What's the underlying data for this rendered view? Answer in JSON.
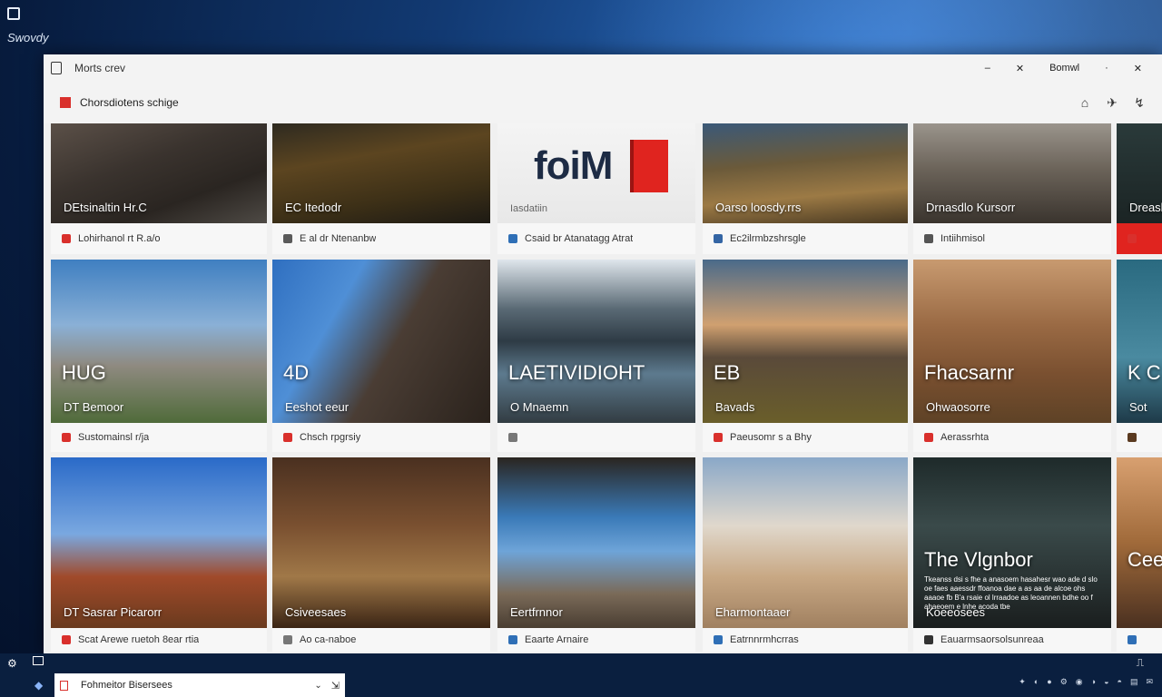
{
  "desktop": {
    "label": "Swovdy"
  },
  "window": {
    "title": "Morts crev",
    "controls": {
      "minimize": "–",
      "restore": "✕",
      "user": "Bomwl",
      "more": "·",
      "close": "✕"
    }
  },
  "toolbar": {
    "title": "Chorsdiotens schige",
    "buttons": [
      "⌂",
      "✈",
      "↯"
    ]
  },
  "tiles": [
    {
      "caption": "DEtsinaltin Hr.C",
      "meta": "Lohirhanol rt R.a/o",
      "icon_color": "#d9302c"
    },
    {
      "caption": "EC Itedodr",
      "meta": "E al dr Ntenanbw",
      "icon_color": "#5a5a5a"
    },
    {
      "logo": "foiM",
      "caption": "Iasdatiin",
      "meta": "Csaid br Atanatagg Atrat",
      "icon_color": "#2f6fb6"
    },
    {
      "caption": "Oarso loosdy.rrs",
      "meta": "Ec2ilrmbzshrsgle",
      "icon_color": "#3465a4"
    },
    {
      "caption": "Drnasdlo Kursorr",
      "meta": "Intiihmisol",
      "icon_color": "#555555"
    },
    {
      "caption": "Dreasb",
      "meta": "",
      "icon_color": "#d9302c"
    },
    {
      "big": "HUG",
      "caption": "DT Bemoor",
      "meta": "Sustomainsl r/ja",
      "icon_color": "#d9302c"
    },
    {
      "big": "4D",
      "caption": "Eeshot eeur",
      "meta": "Chsch rpgrsiy",
      "icon_color": "#d9302c"
    },
    {
      "big": "LAETIVIDIOHT",
      "caption": "O Mnaemn",
      "meta": "",
      "icon_color": "#777777"
    },
    {
      "big": "EB",
      "caption": "Bavads",
      "meta": "Paeusomr s a Bhy",
      "icon_color": "#d9302c"
    },
    {
      "big": "Fhacsarnr",
      "caption": "Ohwaosorre",
      "meta": "Aerassrhta",
      "icon_color": "#d9302c"
    },
    {
      "big": "K C",
      "caption": "Sot",
      "meta": "",
      "icon_color": "#5a3a20"
    },
    {
      "caption": "DT Sasrar Picarorr",
      "meta": "Scat Arewe ruetoh 8ear rtia",
      "icon_color": "#d9302c"
    },
    {
      "caption": "Csiveesaes",
      "meta": "Ao ca-naboe",
      "icon_color": "#777777"
    },
    {
      "caption": "Eertfrnnor",
      "meta": "Eaarte Arnaire",
      "icon_color": "#2f6fb6"
    },
    {
      "caption": "Eharmontaaer",
      "meta": "Eatrnnrmhcrras",
      "icon_color": "#2f6fb6"
    },
    {
      "big": "The Vlgnbor",
      "caption": "Koeeosees",
      "meta": "Eauarmsaorsolsunreaa",
      "icon_color": "#333333",
      "desc": "Tkeanss dsi s fhe a anasoem hasahesr wao ade d slo oe faes aaessdr ffoanoa dae a as aa de alcoe ohs aaaoe fb B'a rsaie ol lrraadoe as leoannen bdhe oo f ahaeoem e lnhe acoda tbe"
    },
    {
      "big": "Cee",
      "caption": "",
      "meta": "",
      "icon_color": "#2f6fb6"
    }
  ],
  "taskbar": {
    "search_text": "Fohmeitor Bisersees",
    "chevron": "⌄",
    "pin": "⇲",
    "tray": [
      "✦",
      "◐",
      "●",
      "⚙",
      "◉",
      "◑",
      "◒",
      "◓",
      "▤",
      "✉"
    ],
    "top_right": "⎍"
  }
}
